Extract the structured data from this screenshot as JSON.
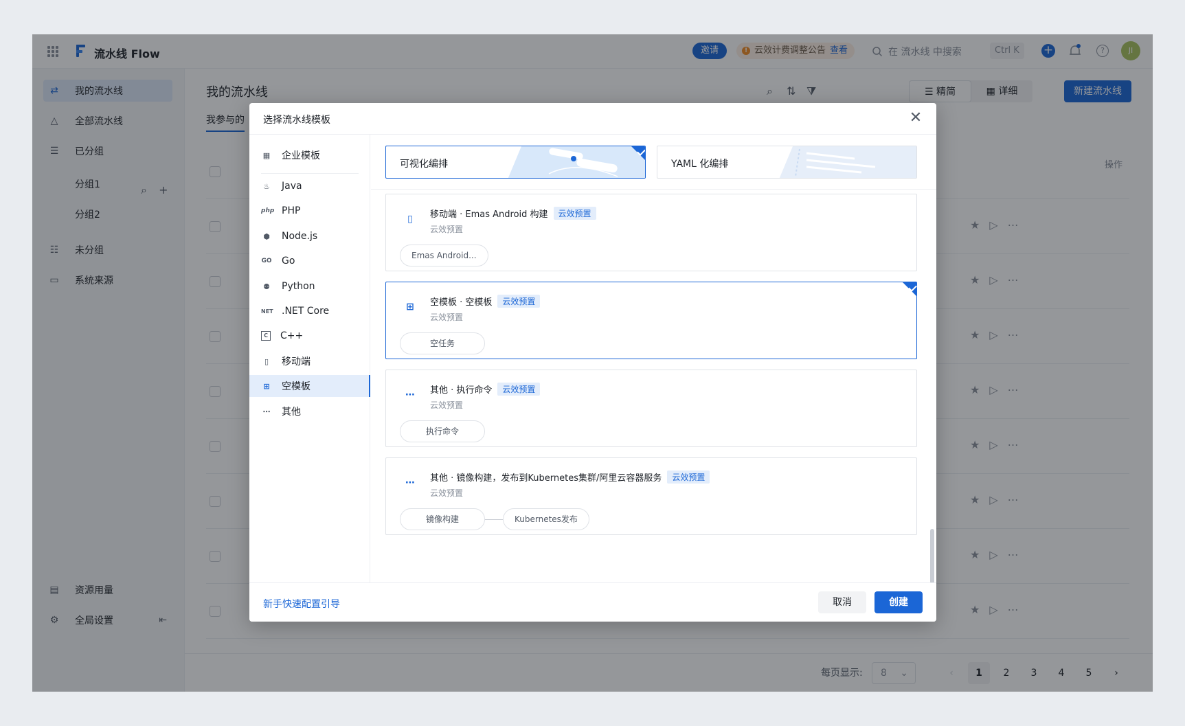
{
  "app": {
    "brand": "流水线 Flow",
    "invite_label": "邀请",
    "notice_text": "云效计费调整公告",
    "notice_link": "查看",
    "search_placeholder": "在 流水线 中搜索",
    "search_shortcut": "Ctrl K",
    "avatar_initials": "JI"
  },
  "sidebar": {
    "my_pipelines": "我的流水线",
    "all_pipelines": "全部流水线",
    "grouped": "已分组",
    "groups": [
      "分组1",
      "分组2"
    ],
    "ungrouped": "未分组",
    "system_source": "系统来源",
    "resource_usage": "资源用量",
    "global_settings": "全局设置"
  },
  "main": {
    "title": "我的流水线",
    "tab": "我参与的",
    "view_compact": "精简",
    "view_detail": "详细",
    "new_button": "新建流水线",
    "ops_header": "操作",
    "per_page_label": "每页显示:",
    "per_page_value": "8",
    "pages": [
      "1",
      "2",
      "3",
      "4",
      "5"
    ],
    "current_page": "1"
  },
  "modal": {
    "title": "选择流水线模板",
    "modes": [
      {
        "label": "可视化编排",
        "selected": true
      },
      {
        "label": "YAML 化编排",
        "selected": false
      }
    ],
    "categories": [
      {
        "label": "企业模板",
        "icon": "grid-icon"
      },
      {
        "label": "Java",
        "icon": "java-icon"
      },
      {
        "label": "PHP",
        "icon": "php-icon"
      },
      {
        "label": "Node.js",
        "icon": "nodejs-icon"
      },
      {
        "label": "Go",
        "icon": "go-icon"
      },
      {
        "label": "Python",
        "icon": "python-icon"
      },
      {
        "label": ".NET Core",
        "icon": "dotnet-icon"
      },
      {
        "label": "C++",
        "icon": "cpp-icon"
      },
      {
        "label": "移动端",
        "icon": "mobile-icon"
      },
      {
        "label": "空模板",
        "icon": "blank-template-icon"
      },
      {
        "label": "其他",
        "icon": "more-icon"
      }
    ],
    "active_category": "空模板",
    "templates": [
      {
        "name": "移动端 · Emas Android 构建",
        "tag": "云效预置",
        "source": "云效预置",
        "steps": [
          "Emas Android..."
        ],
        "icon": "mobile-icon",
        "selected": false
      },
      {
        "name": "空模板 · 空模板",
        "tag": "云效预置",
        "source": "云效预置",
        "steps": [
          "空任务"
        ],
        "icon": "blank-template-icon",
        "selected": true
      },
      {
        "name": "其他 · 执行命令",
        "tag": "云效预置",
        "source": "云效预置",
        "steps": [
          "执行命令"
        ],
        "icon": "more-icon",
        "selected": false
      },
      {
        "name": "其他 · 镜像构建，发布到Kubernetes集群/阿里云容器服务",
        "tag": "云效预置",
        "source": "云效预置",
        "steps": [
          "镜像构建",
          "Kubernetes发布"
        ],
        "icon": "more-icon",
        "selected": false
      }
    ],
    "guide_link": "新手快速配置引导",
    "cancel_label": "取消",
    "create_label": "创建"
  },
  "colors": {
    "primary": "#1b66d6",
    "tag_bg": "#e3edfb",
    "mask": "rgba(20,24,30,0.45)"
  }
}
